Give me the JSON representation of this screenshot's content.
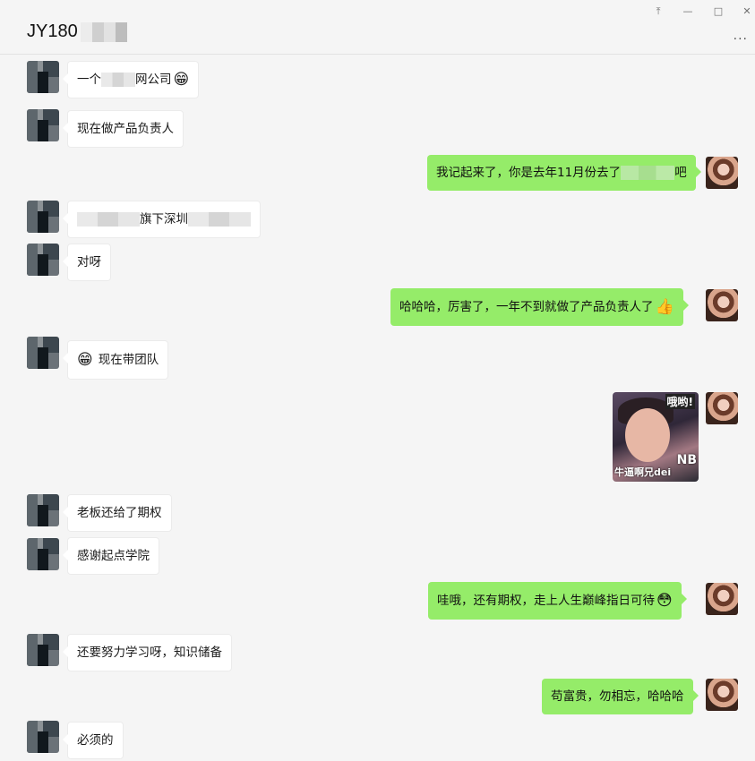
{
  "header": {
    "title": "JY180",
    "controls": [
      "pin-icon",
      "minimize-icon",
      "maximize-icon",
      "close-icon"
    ],
    "more": "···"
  },
  "messages": [
    {
      "side": "in",
      "pre": "一个",
      "post": "网公司",
      "emoji": "😁"
    },
    {
      "side": "in",
      "text": "现在做产品负责人"
    },
    {
      "side": "out",
      "pre": "我记起来了，你是去年11月份去了",
      "post": "吧"
    },
    {
      "side": "in",
      "mid": "旗下深圳"
    },
    {
      "side": "in",
      "text": "对呀"
    },
    {
      "side": "out",
      "text": "哈哈哈，厉害了，一年不到就做了产品负责人了",
      "emoji": "👍"
    },
    {
      "side": "in",
      "text": "现在带团队",
      "emoji_pre": "😁"
    },
    {
      "side": "out",
      "type": "sticker",
      "sticker": {
        "top": "哦哟!",
        "bottom": "牛逼啊兄dei",
        "mark": "NB"
      }
    },
    {
      "side": "in",
      "text": "老板还给了期权"
    },
    {
      "side": "in",
      "text": "感谢起点学院"
    },
    {
      "side": "out",
      "text": "哇哦，还有期权，走上人生巅峰指日可待",
      "emoji": "😳"
    },
    {
      "side": "in",
      "text": "还要努力学习呀，知识储备"
    },
    {
      "side": "out",
      "text": "苟富贵，勿相忘，哈哈哈"
    },
    {
      "side": "in",
      "text": "必须的"
    }
  ]
}
